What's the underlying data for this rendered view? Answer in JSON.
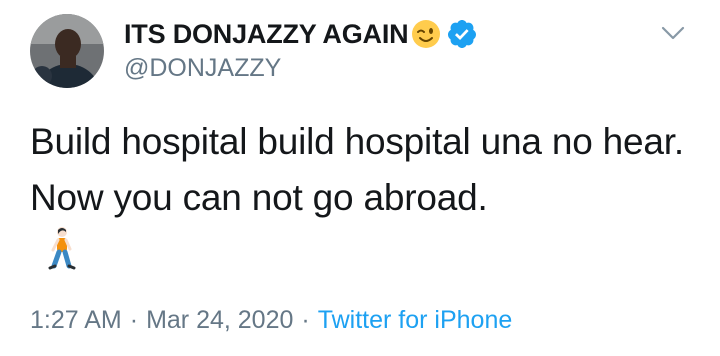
{
  "user": {
    "display_name": "ITS DONJAZZY AGAIN",
    "handle": "@DONJAZZY",
    "name_emoji": "winking-face-icon",
    "verified": true
  },
  "tweet": {
    "text": "Build hospital build hospital una no hear. Now you can not go abroad.",
    "trailing_emoji": "person-walking-icon"
  },
  "meta": {
    "time": "1:27 AM",
    "separator": "·",
    "date": "Mar 24, 2020",
    "source": "Twitter for iPhone"
  },
  "colors": {
    "text": "#14171a",
    "muted": "#657786",
    "accent": "#1da1f2",
    "verified": "#1da1f2"
  }
}
